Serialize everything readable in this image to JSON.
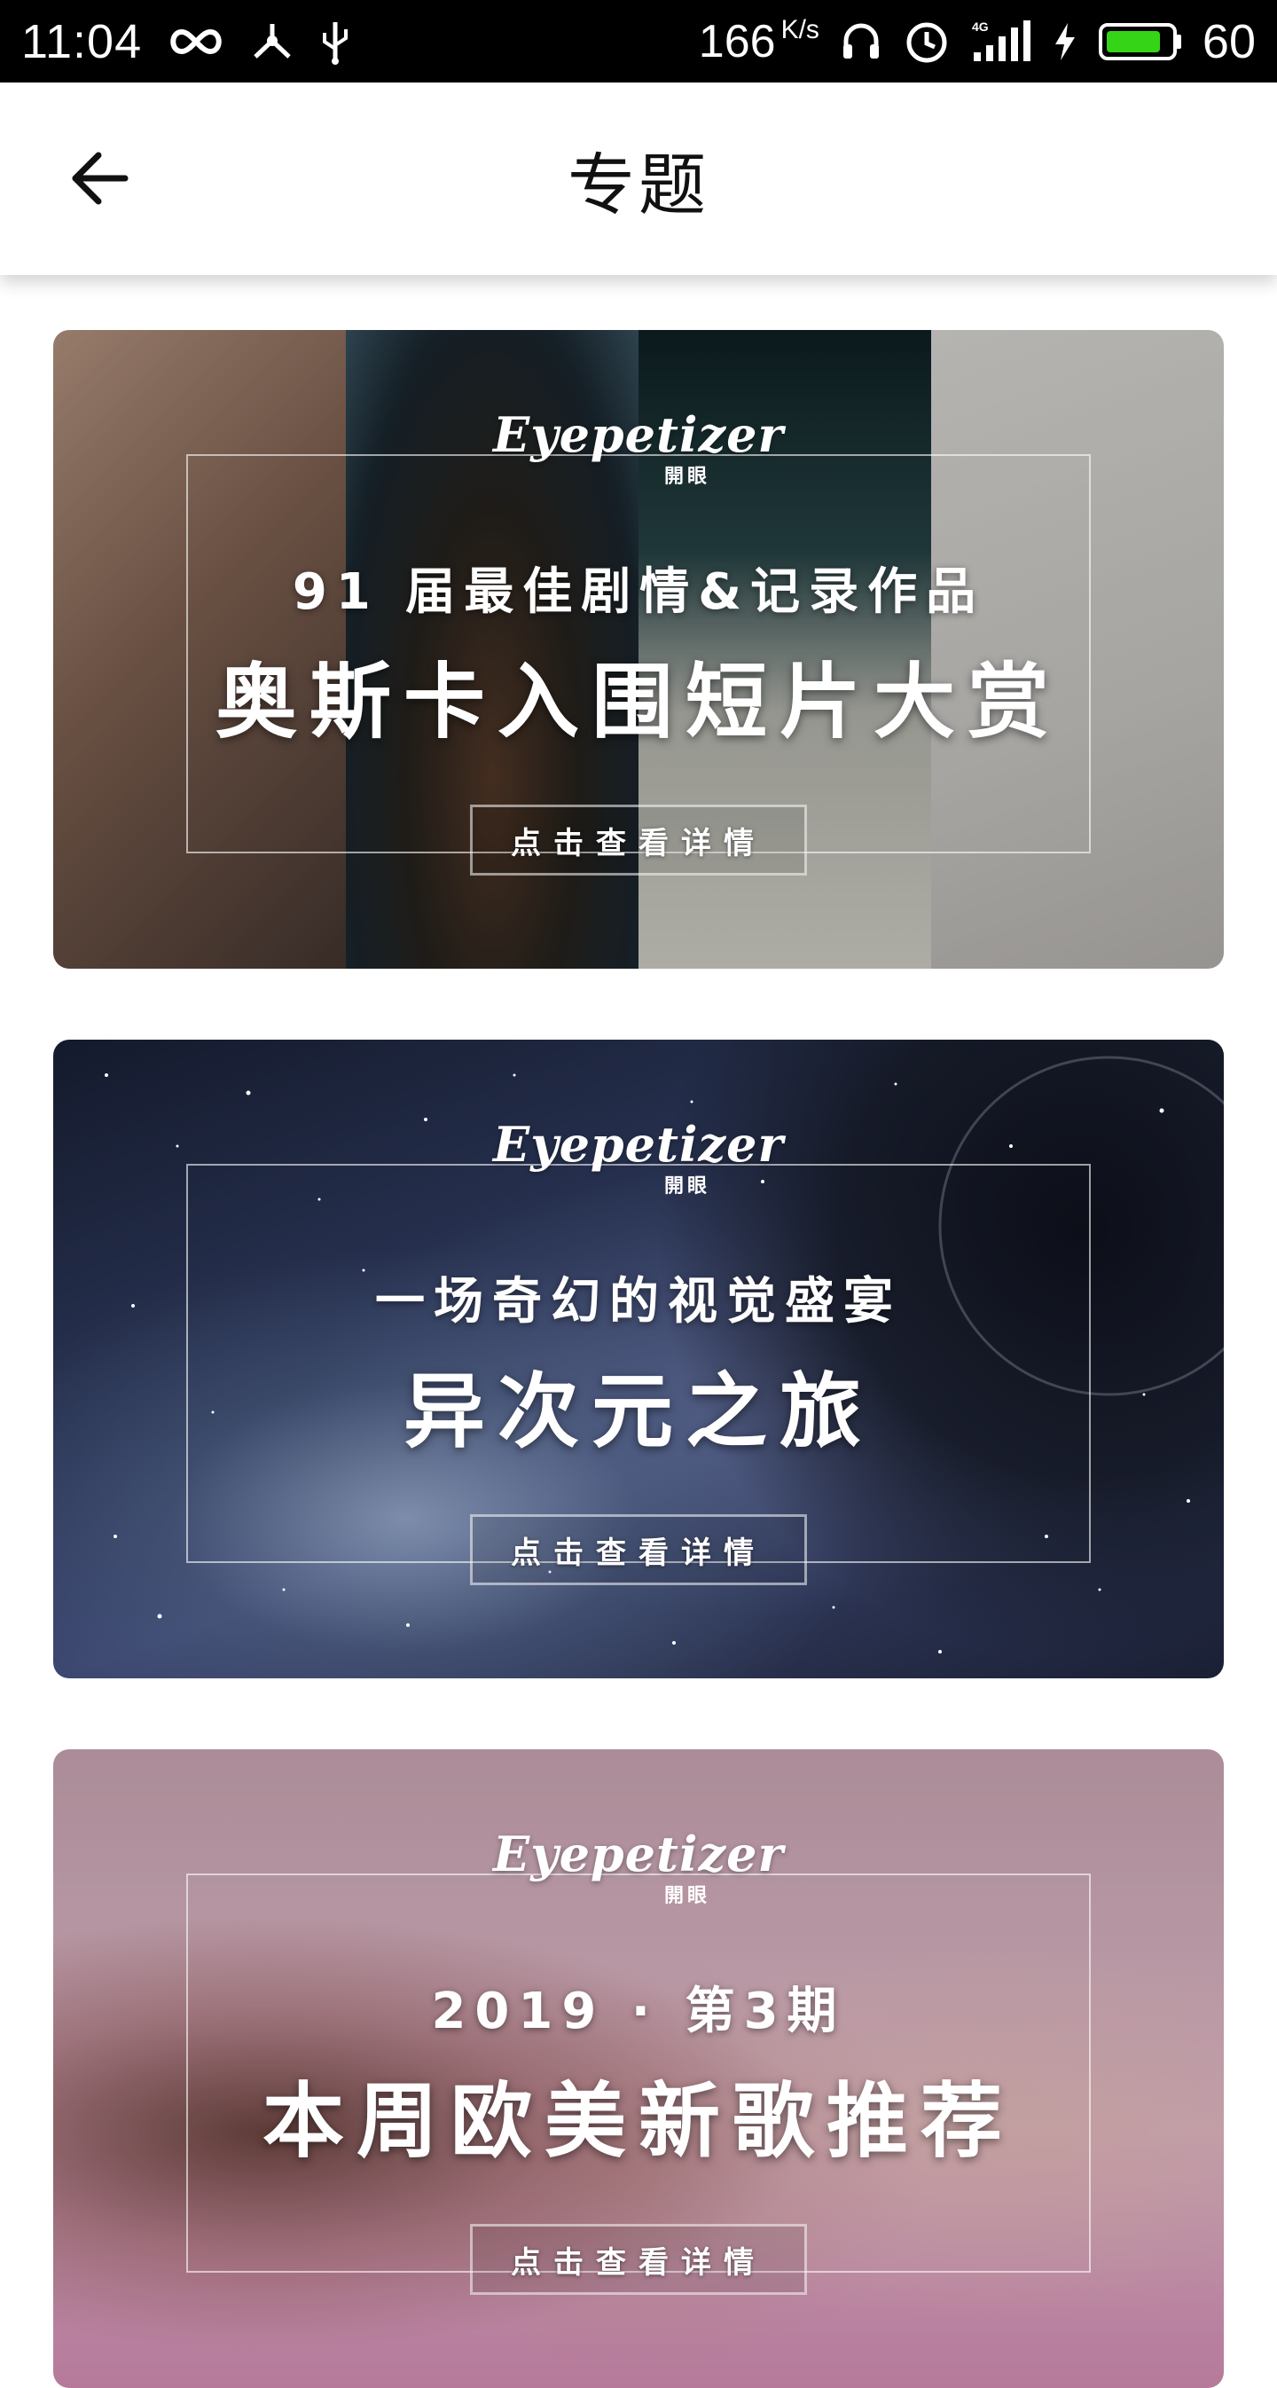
{
  "status_bar": {
    "time": "11:04",
    "net_speed": "166",
    "net_speed_unit": "K/s",
    "battery_level": "60",
    "icons": [
      "infinity-icon",
      "share-node-icon",
      "usb-icon",
      "headphones-icon",
      "alarm-icon",
      "signal-4g-icon",
      "charging-icon",
      "battery-icon"
    ]
  },
  "header": {
    "title": "专题",
    "back_icon": "arrow-left-icon"
  },
  "brand": {
    "script": "Eyepetizer",
    "sub": "開眼"
  },
  "cards": [
    {
      "subtitle": "91 届最佳剧情&记录作品",
      "title": "奥斯卡入围短片大赏",
      "button": "点击查看详情",
      "theme": "portraits"
    },
    {
      "subtitle": "一场奇幻的视觉盛宴",
      "title": "异次元之旅",
      "button": "点击查看详情",
      "theme": "space"
    },
    {
      "subtitle": "2019 · 第3期",
      "title": "本周欧美新歌推荐",
      "button": "点击查看详情",
      "theme": "pink"
    }
  ]
}
